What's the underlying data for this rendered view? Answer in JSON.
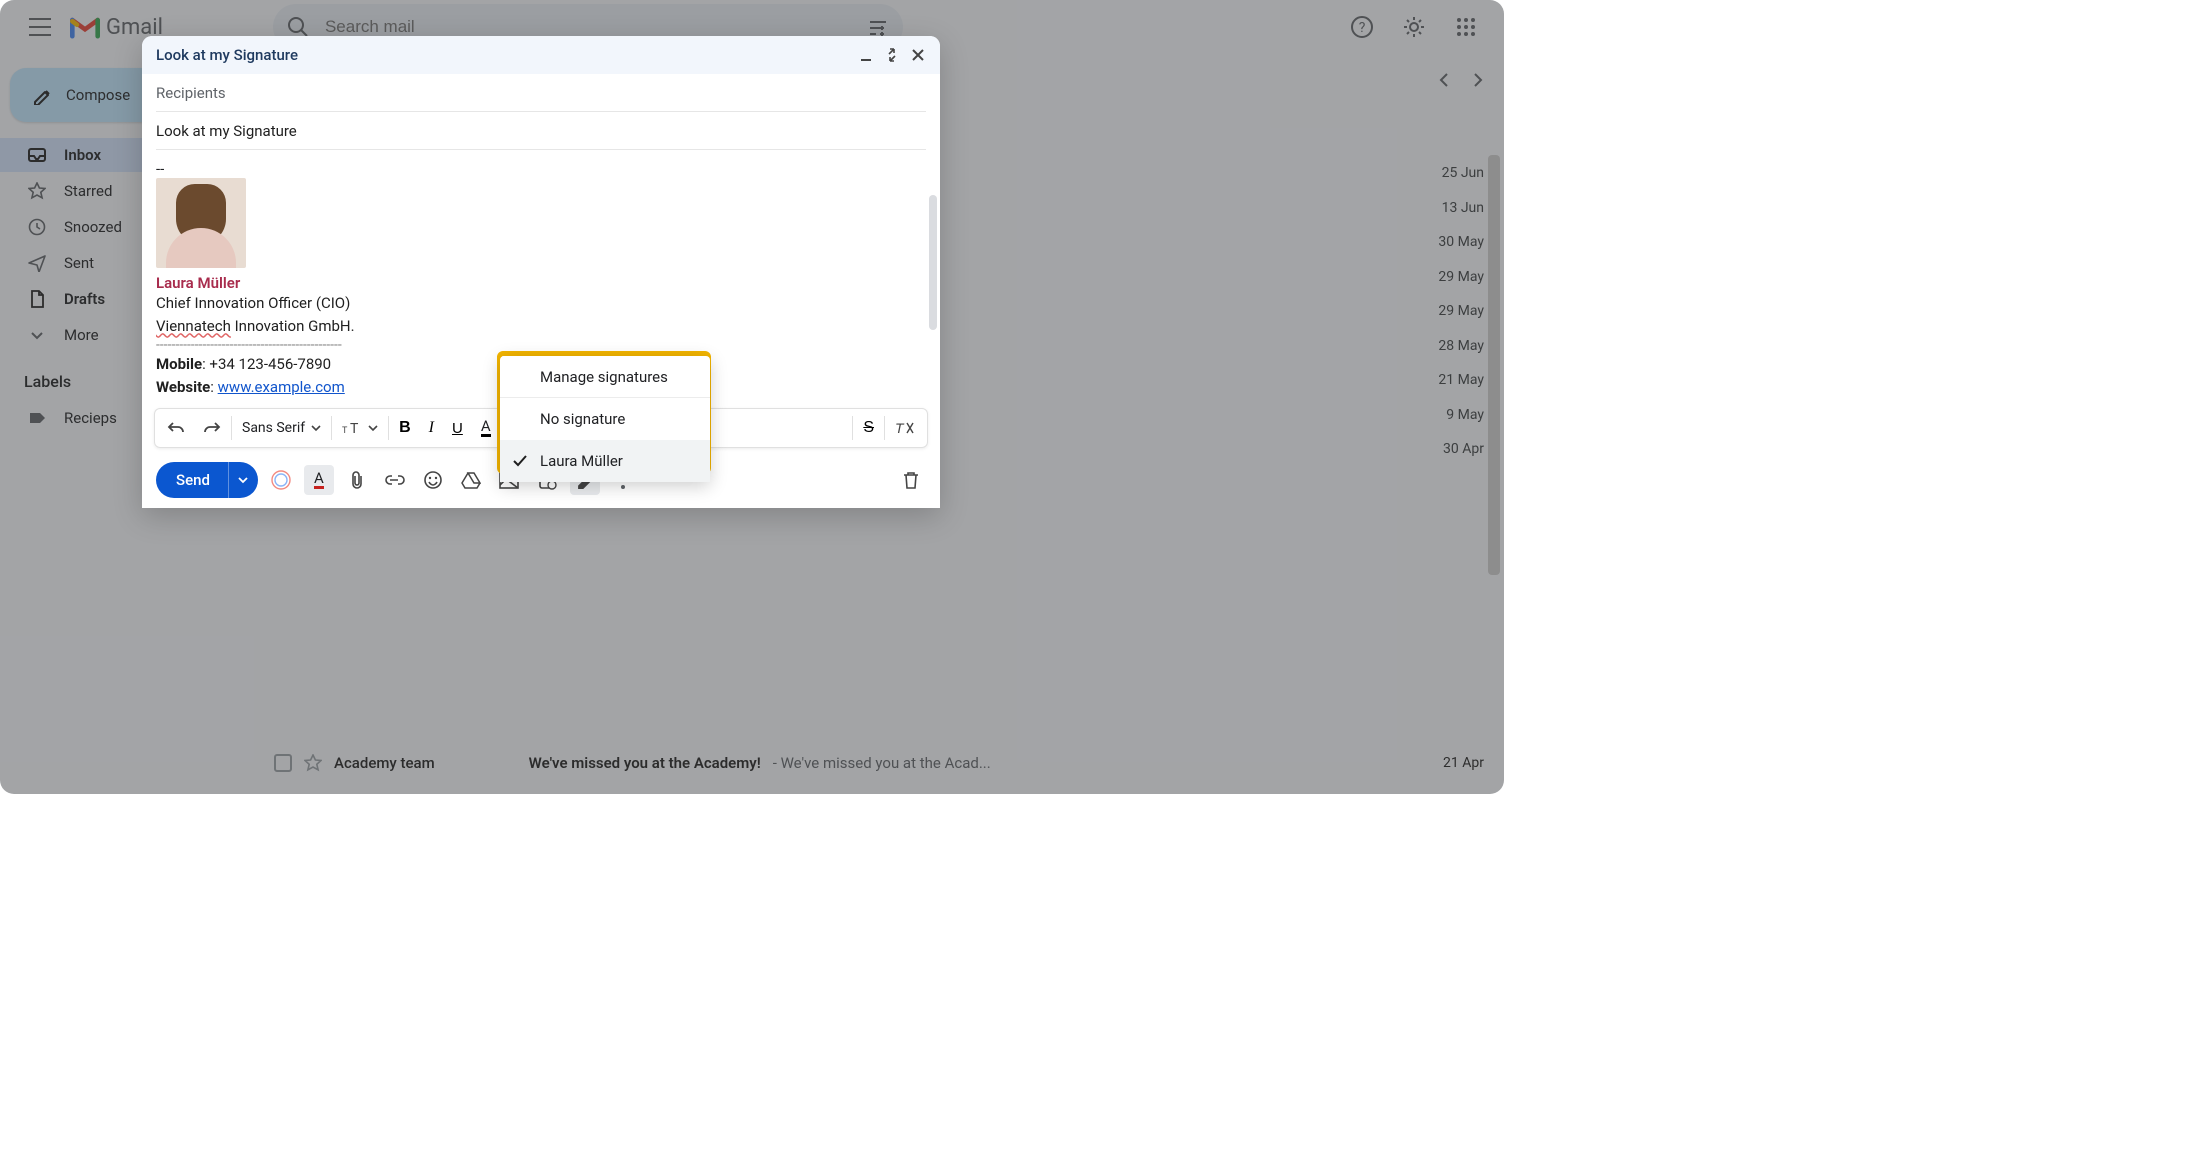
{
  "brand": {
    "name": "Gmail"
  },
  "search": {
    "placeholder": "Search mail"
  },
  "compose_button": "Compose",
  "nav": [
    {
      "id": "inbox",
      "label": "Inbox",
      "active": true,
      "bold": true
    },
    {
      "id": "starred",
      "label": "Starred",
      "active": false,
      "bold": false
    },
    {
      "id": "snoozed",
      "label": "Snoozed",
      "active": false,
      "bold": false
    },
    {
      "id": "sent",
      "label": "Sent",
      "active": false,
      "bold": false
    },
    {
      "id": "drafts",
      "label": "Drafts",
      "active": false,
      "bold": true
    },
    {
      "id": "more",
      "label": "More",
      "active": false,
      "bold": false
    }
  ],
  "labels_header": "Labels",
  "labels": [
    {
      "id": "recieps",
      "label": "Recieps"
    }
  ],
  "dates_column": [
    "25 Jun",
    "13 Jun",
    "30 May",
    "29 May",
    "29 May",
    "28 May",
    "21 May",
    "9 May",
    "30 Apr"
  ],
  "visible_mail_row": {
    "sender": "Academy team",
    "subject": "We've missed you at the Academy!",
    "preview": " - We've missed you at the Acad...",
    "date": "21 Apr"
  },
  "compose": {
    "title": "Look at my Signature",
    "recipients_placeholder": "Recipients",
    "subject": "Look at my Signature",
    "body_separator": "--",
    "signature": {
      "name": "Laura Müller",
      "role": "Chief Innovation Officer (CIO)",
      "company_underlined": "Viennatech",
      "company_suffix": " Innovation GmbH.",
      "rule": "------------------------------------------------",
      "mobile_label": "Mobile",
      "mobile_value": ": +34 123-456-7890",
      "website_label": "Website",
      "website_sep": ": ",
      "website_url": "www.example.com"
    },
    "format_toolbar": {
      "font_family": "Sans Serif"
    },
    "send_label": "Send"
  },
  "signature_menu": {
    "manage": "Manage signatures",
    "none": "No signature",
    "selected": "Laura Müller"
  },
  "colors": {
    "accent": "#0b57d0",
    "compose_bg": "#c2e7ff",
    "highlight": "#f2b400",
    "sig_name": "#a82c4d",
    "link": "#1155cc"
  }
}
